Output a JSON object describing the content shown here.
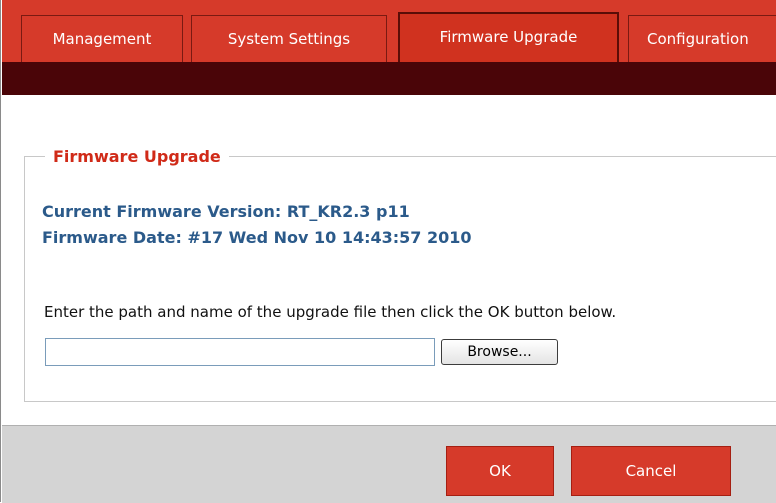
{
  "tabs": [
    {
      "label": "Management",
      "active": false
    },
    {
      "label": "System Settings",
      "active": false
    },
    {
      "label": "Firmware Upgrade",
      "active": true
    },
    {
      "label": "Configuration",
      "active": false
    }
  ],
  "section": {
    "legend": "Firmware Upgrade",
    "current_version": "Current Firmware Version: RT_KR2.3 p11",
    "firmware_date": "Firmware Date: #17 Wed Nov 10 14:43:57 2010",
    "instructions": "Enter the path and name of the upgrade file then click the OK button below.",
    "file_input_value": "",
    "browse_label": "Browse..."
  },
  "footer": {
    "ok_label": "OK",
    "cancel_label": "Cancel"
  },
  "colors": {
    "tab_red": "#d63a2a",
    "dark_bar": "#4a0508",
    "legend_red": "#d02a18",
    "info_blue": "#2b5a8a"
  }
}
